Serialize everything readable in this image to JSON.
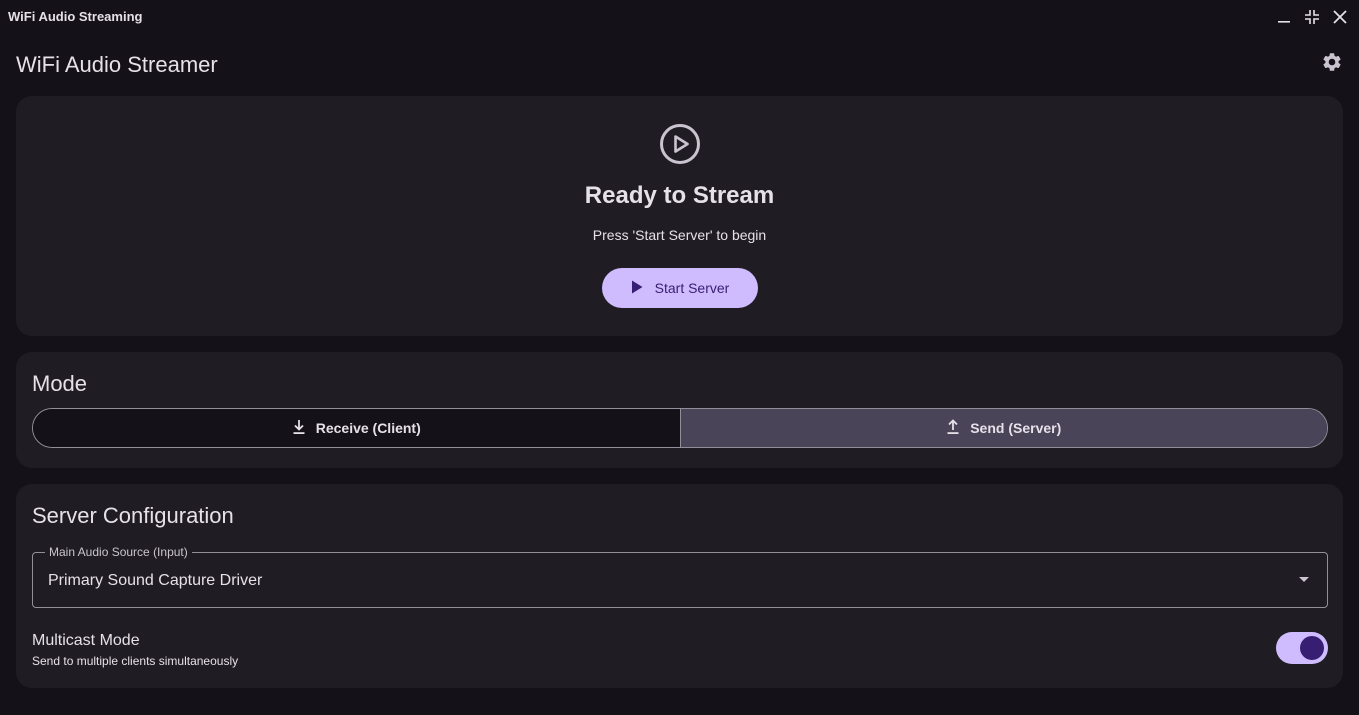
{
  "window": {
    "title": "WiFi Audio Streaming",
    "controls": [
      "minimize-icon",
      "restore-icon",
      "close-icon"
    ]
  },
  "appbar": {
    "title": "WiFi Audio Streamer",
    "settings_icon": "gear-icon"
  },
  "status": {
    "icon": "play-circle-icon",
    "title": "Ready to Stream",
    "subtitle": "Press 'Start Server' to begin",
    "button_label": "Start Server",
    "button_icon": "play-icon"
  },
  "mode": {
    "title": "Mode",
    "options": [
      {
        "label": "Receive (Client)",
        "icon": "download-icon",
        "selected": false
      },
      {
        "label": "Send (Server)",
        "icon": "upload-icon",
        "selected": true
      }
    ]
  },
  "server_config": {
    "title": "Server Configuration",
    "audio_source": {
      "label": "Main Audio Source (Input)",
      "value": "Primary Sound Capture Driver"
    },
    "multicast": {
      "title": "Multicast Mode",
      "subtitle": "Send to multiple clients simultaneously",
      "enabled": true
    }
  },
  "colors": {
    "background": "#141218",
    "surface": "#1f1d23",
    "primary": "#cfbcff",
    "on_primary": "#381e72",
    "selected_segment": "#4a4458",
    "outline": "#938f99"
  }
}
